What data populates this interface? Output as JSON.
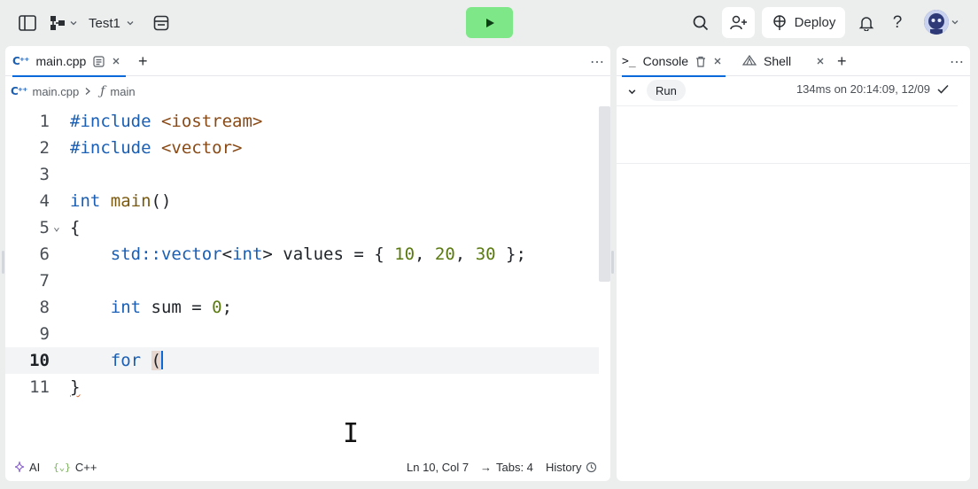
{
  "topbar": {
    "project_name": "Test1",
    "deploy_label": "Deploy"
  },
  "editor": {
    "tab_label": "main.cpp",
    "breadcrumb_file": "main.cpp",
    "breadcrumb_symbol": "main",
    "lines": [
      {
        "n": "1"
      },
      {
        "n": "2"
      },
      {
        "n": "3"
      },
      {
        "n": "4"
      },
      {
        "n": "5"
      },
      {
        "n": "6"
      },
      {
        "n": "7"
      },
      {
        "n": "8"
      },
      {
        "n": "9"
      },
      {
        "n": "10"
      },
      {
        "n": "11"
      }
    ],
    "code": {
      "l1_dir": "#include",
      "l1_inc": "<iostream>",
      "l2_dir": "#include",
      "l2_inc": "<vector>",
      "l4_kw": "int",
      "l4_fn": "main",
      "l4_rest": "()",
      "l5": "{",
      "l6_ns": "std::vector",
      "l6_lt": "<",
      "l6_kw": "int",
      "l6_gt": ">",
      "l6_mid": " values = { ",
      "l6_n1": "10",
      "l6_c1": ", ",
      "l6_n2": "20",
      "l6_c2": ", ",
      "l6_n3": "30",
      "l6_end": " };",
      "l8_kw": "int",
      "l8_mid": " sum = ",
      "l8_num": "0",
      "l8_end": ";",
      "l10_kw": "for",
      "l10_paren": "(",
      "l11": "}"
    },
    "status": {
      "ai_label": "AI",
      "lang_label": "C++",
      "position": "Ln 10, Col 7",
      "tabs": "Tabs: 4",
      "history": "History"
    }
  },
  "console": {
    "tab_console": "Console",
    "tab_shell": "Shell",
    "run_label": "Run",
    "run_time": "134ms on 20:14:09, 12/09"
  },
  "colors": {
    "run_button": "#7ee787",
    "accent": "#0a69da",
    "keyword": "#1a5fb4",
    "number": "#5a7a10"
  }
}
